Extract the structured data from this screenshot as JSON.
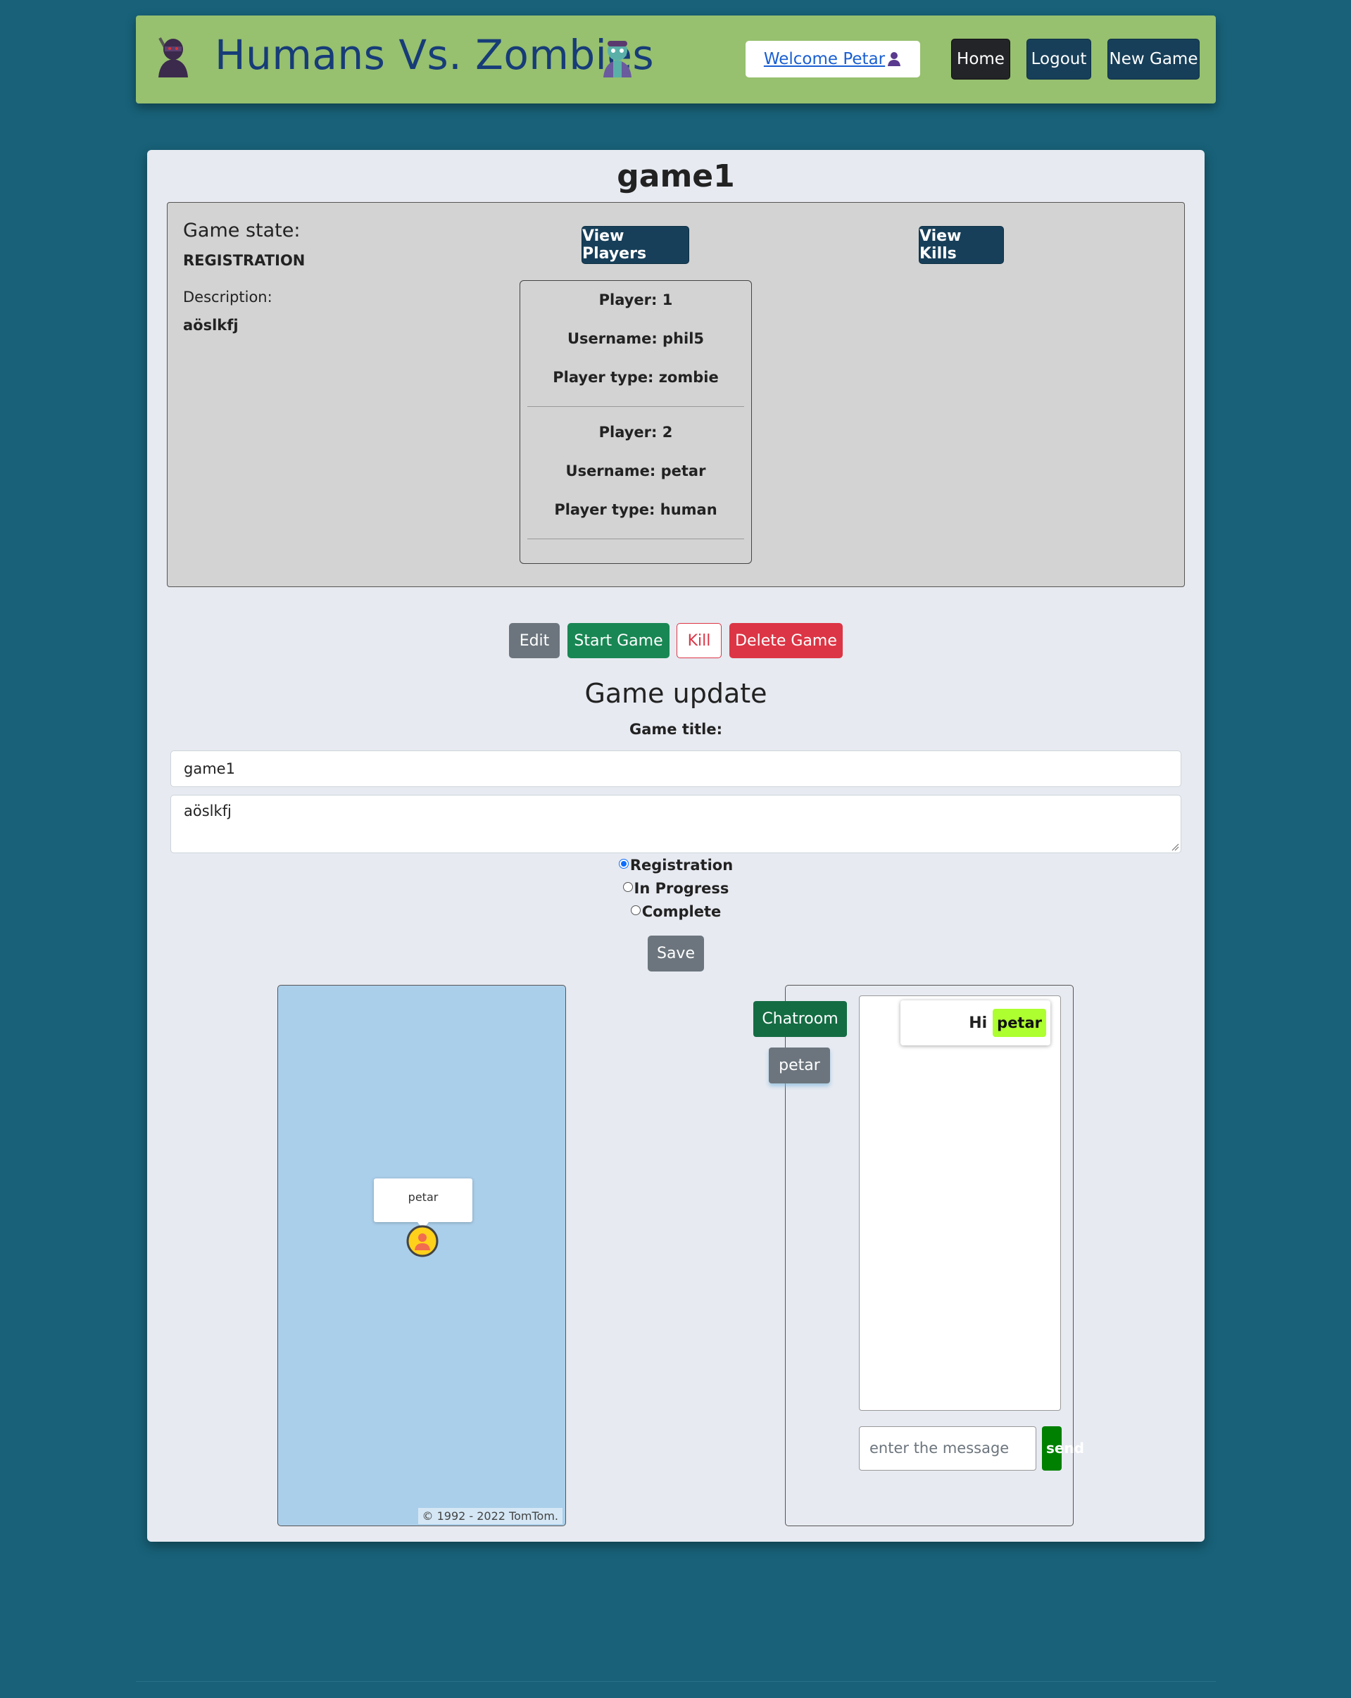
{
  "header": {
    "title": "Humans Vs. Zombies",
    "welcome_link": "Welcome Petar",
    "nav": {
      "home": "Home",
      "logout": "Logout",
      "new_game": "New Game"
    },
    "icons": [
      "ninja-icon",
      "zombie-icon",
      "user-icon"
    ]
  },
  "game": {
    "title": "game1",
    "state_label": "Game state:",
    "state_value": "REGISTRATION",
    "description_label": "Description:",
    "description_value": "aöslkfj",
    "view_players_label": "View Players",
    "view_kills_label": "View Kills",
    "players": [
      {
        "player": "Player: 1",
        "username": "Username: phil5",
        "type": "Player type: zombie"
      },
      {
        "player": "Player: 2",
        "username": "Username: petar",
        "type": "Player type: human"
      }
    ]
  },
  "actions": {
    "edit": "Edit",
    "start_game": "Start Game",
    "kill": "Kill",
    "delete_game": "Delete Game"
  },
  "update_form": {
    "heading": "Game update",
    "title_label": "Game title:",
    "title_value": "game1",
    "description_value": "aöslkfj",
    "states": [
      {
        "label": "Registration",
        "checked": true
      },
      {
        "label": "In Progress",
        "checked": false
      },
      {
        "label": "Complete",
        "checked": false
      }
    ],
    "save_label": "Save"
  },
  "map": {
    "marker_label": "petar",
    "copyright": "© 1992 - 2022 TomTom."
  },
  "chat": {
    "tab_main": "Chatroom",
    "tab_user": "petar",
    "messages": [
      {
        "text": "Hi",
        "user": "petar"
      }
    ],
    "input_placeholder": "enter the message",
    "send_label": "send"
  },
  "colors": {
    "background": "#186178",
    "header": "#97c06f",
    "title": "#173c78",
    "dark_button": "#173f59",
    "success": "#198754",
    "danger": "#dc3545",
    "secondary": "#6c757d",
    "highlight_user": "#adff2f"
  }
}
